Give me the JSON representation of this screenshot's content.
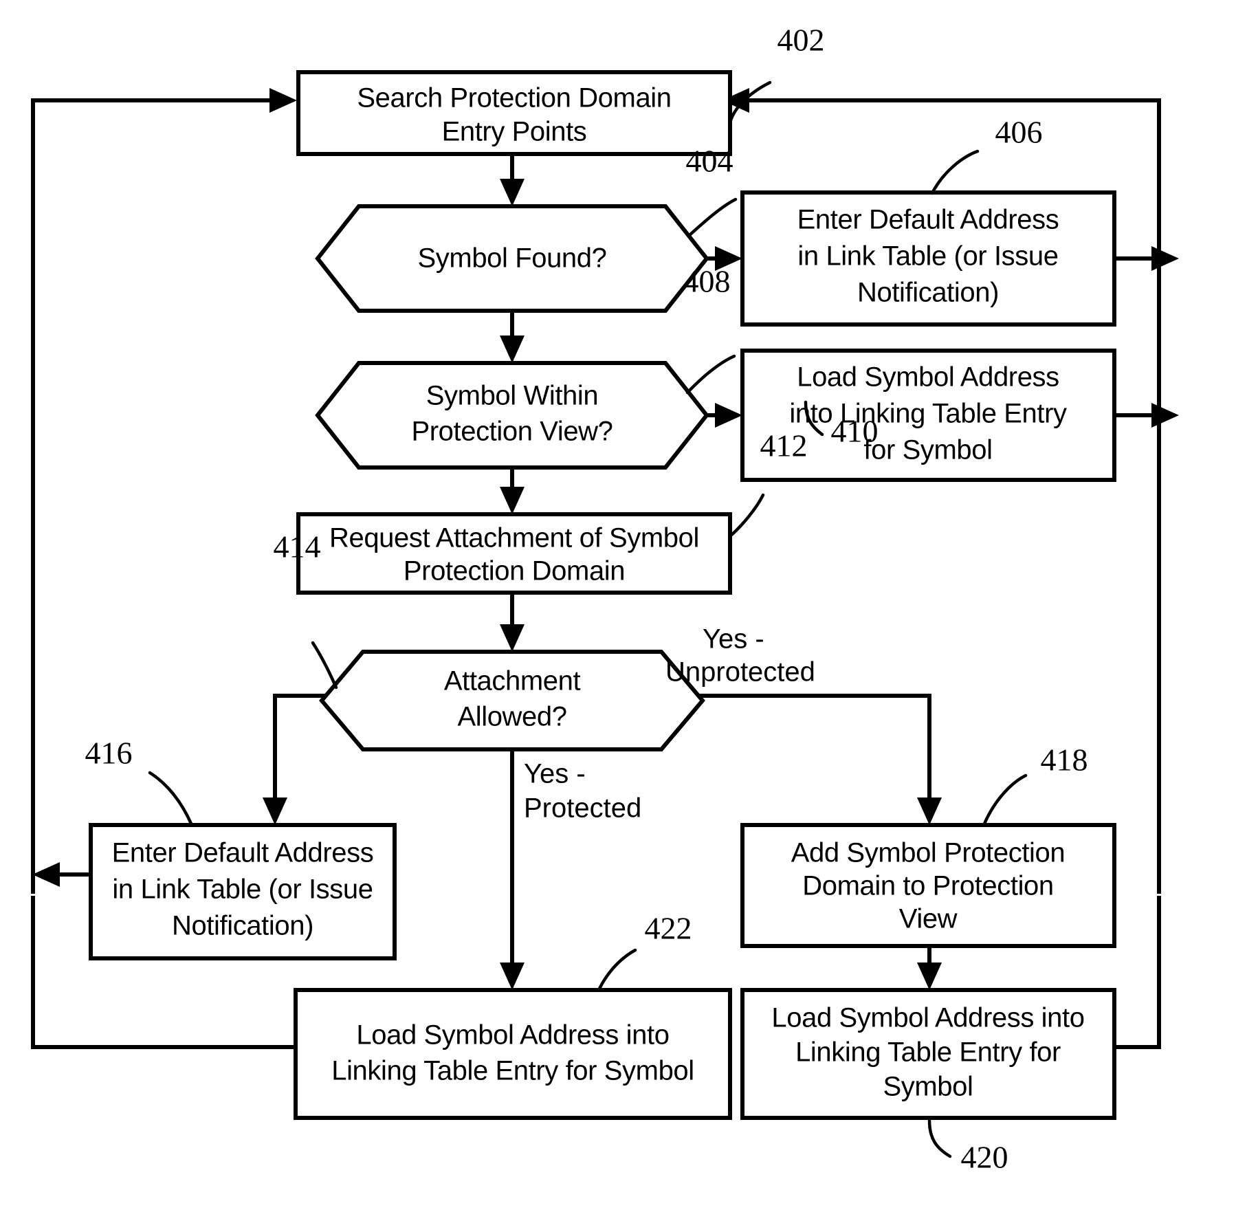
{
  "figure": {
    "type": "patent-flowchart",
    "background_color": "#ffffff",
    "line_color": "#000000"
  },
  "nodes": {
    "n402": {
      "ref": "402",
      "shape": "process",
      "lines": [
        "Search Protection Domain",
        "Entry Points"
      ]
    },
    "n404": {
      "ref": "404",
      "shape": "decision",
      "lines": [
        "Symbol Found?"
      ]
    },
    "n406": {
      "ref": "406",
      "shape": "process",
      "lines": [
        "Enter Default Address",
        "in Link Table (or Issue",
        "Notification)"
      ]
    },
    "n408": {
      "ref": "408",
      "shape": "decision",
      "lines": [
        "Symbol Within",
        "Protection View?"
      ]
    },
    "n410": {
      "ref": "410",
      "shape": "process",
      "lines": [
        "Load Symbol Address",
        "into Linking Table Entry",
        "for Symbol"
      ]
    },
    "n412": {
      "ref": "412",
      "shape": "process",
      "lines": [
        "Request Attachment of Symbol",
        "Protection Domain"
      ]
    },
    "n414": {
      "ref": "414",
      "shape": "decision",
      "lines": [
        "Attachment",
        "Allowed?"
      ]
    },
    "n416": {
      "ref": "416",
      "shape": "process",
      "lines": [
        "Enter Default Address",
        "in Link Table (or Issue",
        "Notification)"
      ]
    },
    "n418": {
      "ref": "418",
      "shape": "process",
      "lines": [
        "Add Symbol Protection",
        "Domain to Protection",
        "View"
      ]
    },
    "n420": {
      "ref": "420",
      "shape": "process",
      "lines": [
        "Load Symbol Address into",
        "Linking Table Entry for",
        "Symbol"
      ]
    },
    "n422": {
      "ref": "422",
      "shape": "process",
      "lines": [
        "Load Symbol Address into",
        "Linking Table Entry for Symbol"
      ]
    }
  },
  "edge_labels": {
    "yes_unprotected": [
      "Yes -",
      "Unprotected"
    ],
    "yes_protected": [
      "Yes -",
      "Protected"
    ]
  }
}
